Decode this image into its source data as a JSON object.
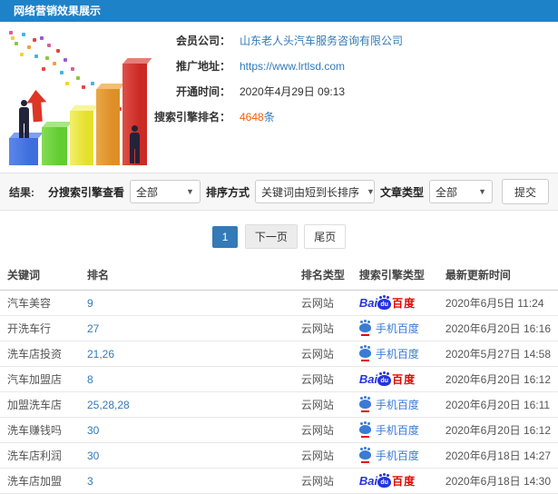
{
  "header": {
    "title": "网络营销效果展示"
  },
  "info": {
    "rows": [
      {
        "label": "会员公司：",
        "value": "山东老人头汽车服务咨询有限公司"
      },
      {
        "label": "推广地址：",
        "value": "https://www.lrtlsd.com"
      },
      {
        "label": "开通时间：",
        "value": "2020年4月29日 09:13"
      },
      {
        "label": "搜索引擎排名：",
        "count": "4648",
        "unit": "条"
      }
    ]
  },
  "filters": {
    "result_label": "结果:",
    "engine_filter_label": "分搜索引擎查看",
    "engine_filter_value": "全部",
    "sort_label": "排序方式",
    "sort_value": "关键词由短到长排序",
    "article_type_label": "文章类型",
    "article_type_value": "全部",
    "submit_label": "提交",
    "caret": "▼"
  },
  "pagination": {
    "current": "1",
    "next": "下一页",
    "last": "尾页"
  },
  "table": {
    "headers": [
      "关键词",
      "排名",
      "排名类型",
      "搜索引擎类型",
      "最新更新时间"
    ],
    "engine_logos": {
      "baidu": {
        "bai": "Bai",
        "du": "du",
        "cn": "百度"
      },
      "mobile": {
        "label": "手机百度"
      }
    },
    "rows": [
      {
        "keyword": "汽车美容",
        "rank": "9",
        "rank_type": "云网站",
        "engine": "baidu",
        "updated": "2020年6月5日 11:24"
      },
      {
        "keyword": "开洗车行",
        "rank": "27",
        "rank_type": "云网站",
        "engine": "mobile",
        "updated": "2020年6月20日 16:16"
      },
      {
        "keyword": "洗车店投资",
        "rank": "21,26",
        "rank_type": "云网站",
        "engine": "mobile",
        "updated": "2020年5月27日 14:58"
      },
      {
        "keyword": "汽车加盟店",
        "rank": "8",
        "rank_type": "云网站",
        "engine": "baidu",
        "updated": "2020年6月20日 16:12"
      },
      {
        "keyword": "加盟洗车店",
        "rank": "25,28,28",
        "rank_type": "云网站",
        "engine": "mobile",
        "updated": "2020年6月20日 16:11"
      },
      {
        "keyword": "洗车赚钱吗",
        "rank": "30",
        "rank_type": "云网站",
        "engine": "mobile",
        "updated": "2020年6月20日 16:12"
      },
      {
        "keyword": "洗车店利润",
        "rank": "30",
        "rank_type": "云网站",
        "engine": "mobile",
        "updated": "2020年6月18日 14:27"
      },
      {
        "keyword": "洗车店加盟",
        "rank": "3",
        "rank_type": "云网站",
        "engine": "baidu",
        "updated": "2020年6月18日 14:30"
      }
    ]
  },
  "colors": {
    "header_bg": "#1e82c8",
    "link": "#337ab7",
    "rank_count": "#ff5a00",
    "baidu_blue": "#2534e0",
    "baidu_red": "#e10602"
  }
}
